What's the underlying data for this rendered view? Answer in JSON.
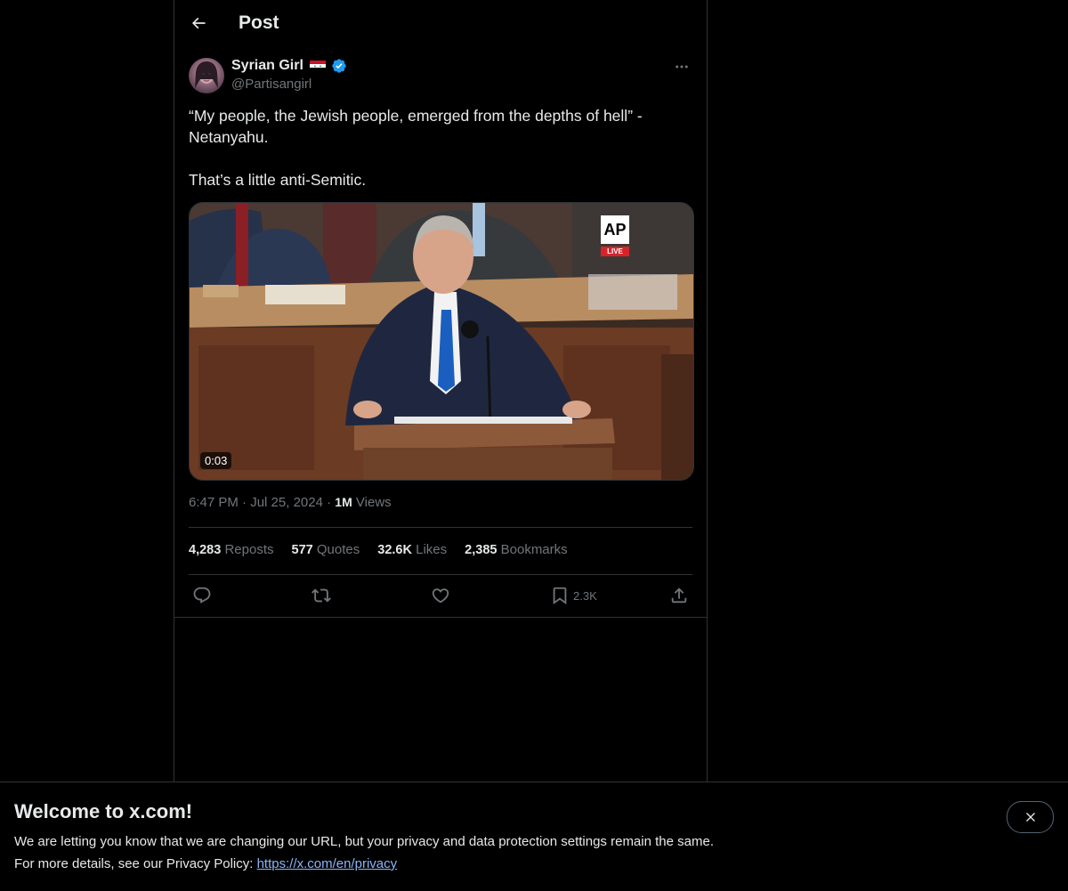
{
  "header": {
    "title": "Post"
  },
  "author": {
    "display_name": "Syrian Girl",
    "handle": "@Partisangirl"
  },
  "tweet": {
    "text": "“My people, the Jewish people, emerged from the depths of hell” - Netanyahu.\n\nThat’s a little anti-Semitic.",
    "media": {
      "duration": "0:03",
      "badge_logo": "AP",
      "badge_live": "LIVE"
    },
    "time": "6:47 PM",
    "date": "Jul 25, 2024",
    "views_count": "1M",
    "views_label": "Views"
  },
  "stats": [
    {
      "value": "4,283",
      "label": "Reposts"
    },
    {
      "value": "577",
      "label": "Quotes"
    },
    {
      "value": "32.6K",
      "label": "Likes"
    },
    {
      "value": "2,385",
      "label": "Bookmarks"
    }
  ],
  "actions": {
    "bookmark_count": "2.3K",
    "icons": [
      "reply-icon",
      "repost-icon",
      "like-icon",
      "bookmark-icon",
      "share-icon"
    ]
  },
  "banner": {
    "title": "Welcome to x.com!",
    "line1": "We are letting you know that we are changing our URL, but your privacy and data protection settings remain the same.",
    "line2_prefix": "For more details, see our Privacy Policy: ",
    "link": "https://x.com/en/privacy"
  },
  "colors": {
    "background": "#000000",
    "text": "#e7e9ea",
    "secondary": "#71767b",
    "border": "#2f3336",
    "verified": "#1d9bf0",
    "link": "#8ab4f8"
  }
}
